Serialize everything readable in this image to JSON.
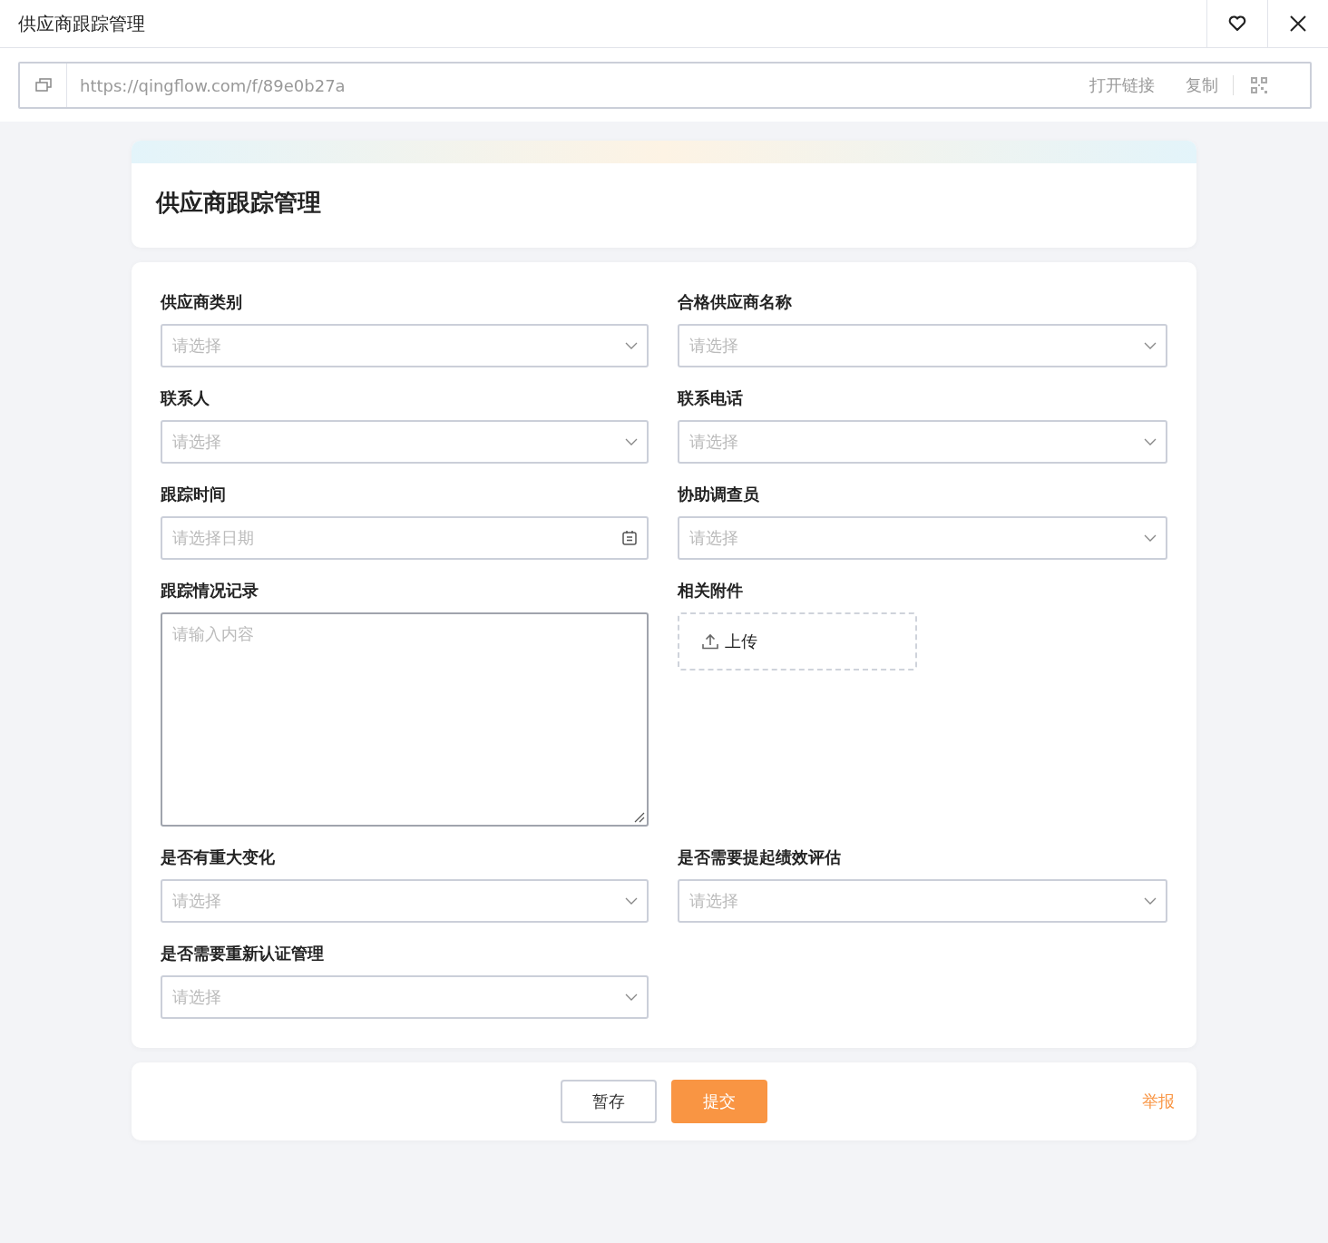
{
  "window": {
    "title": "供应商跟踪管理"
  },
  "link_bar": {
    "url": "https://qingflow.com/f/89e0b27a",
    "open_link": "打开链接",
    "copy": "复制"
  },
  "form": {
    "title": "供应商跟踪管理",
    "fields": [
      {
        "label": "供应商类别",
        "kind": "select",
        "placeholder": "请选择"
      },
      {
        "label": "合格供应商名称",
        "kind": "select",
        "placeholder": "请选择"
      },
      {
        "label": "联系人",
        "kind": "select",
        "placeholder": "请选择"
      },
      {
        "label": "联系电话",
        "kind": "select",
        "placeholder": "请选择"
      },
      {
        "label": "跟踪时间",
        "kind": "date",
        "placeholder": "请选择日期"
      },
      {
        "label": "协助调查员",
        "kind": "select",
        "placeholder": "请选择"
      },
      {
        "label": "跟踪情况记录",
        "kind": "textarea",
        "placeholder": "请输入内容"
      },
      {
        "label": "相关附件",
        "kind": "upload",
        "button": "上传"
      },
      {
        "label": "是否有重大变化",
        "kind": "select",
        "placeholder": "请选择"
      },
      {
        "label": "是否需要提起绩效评估",
        "kind": "select",
        "placeholder": "请选择"
      },
      {
        "label": "是否需要重新认证管理",
        "kind": "select",
        "placeholder": "请选择"
      }
    ]
  },
  "footer": {
    "save": "暂存",
    "submit": "提交",
    "report": "举报"
  }
}
